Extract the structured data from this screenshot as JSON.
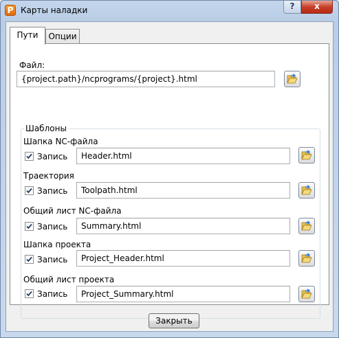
{
  "window": {
    "title": "Карты наладки",
    "help_label": "?",
    "close_label": "x",
    "app_icon_letter": "P"
  },
  "tabs": [
    {
      "label": "Пути",
      "active": true
    },
    {
      "label": "Опции",
      "active": false
    }
  ],
  "file": {
    "label": "Файл:",
    "value": "{project.path}/ncprograms/{project}.html"
  },
  "templates": {
    "title": "Шаблоны",
    "record_label": "Запись",
    "items": [
      {
        "label": "Шапка NC-файла",
        "checked": true,
        "value": "Header.html"
      },
      {
        "label": "Траектория",
        "checked": true,
        "value": "Toolpath.html"
      },
      {
        "label": "Общий лист NC-файла",
        "checked": true,
        "value": "Summary.html"
      },
      {
        "label": "Шапка проекта",
        "checked": true,
        "value": "Project_Header.html"
      },
      {
        "label": "Общий лист проекта",
        "checked": true,
        "value": "Project_Summary.html"
      }
    ]
  },
  "footer": {
    "close_button": "Закрыть"
  },
  "icons": {
    "browse": "folder-open-icon",
    "check": "checkmark-icon"
  }
}
